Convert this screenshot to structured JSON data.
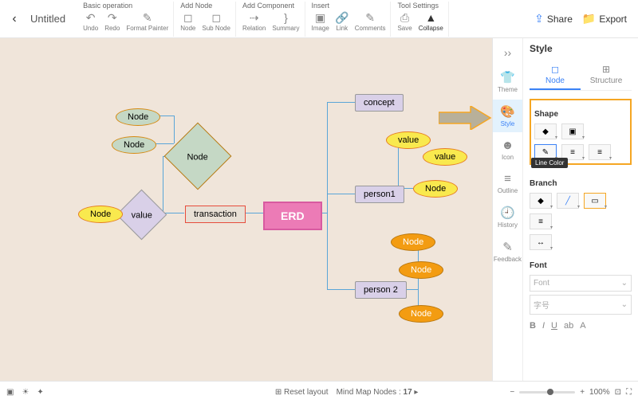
{
  "header": {
    "title": "Untitled",
    "share": "Share",
    "export": "Export",
    "groups": [
      {
        "title": "Basic operation",
        "items": [
          {
            "id": "undo",
            "label": "Undo",
            "icon": "↶"
          },
          {
            "id": "redo",
            "label": "Redo",
            "icon": "↷"
          },
          {
            "id": "format-painter",
            "label": "Format Painter",
            "icon": "✎"
          }
        ]
      },
      {
        "title": "Add Node",
        "items": [
          {
            "id": "node",
            "label": "Node",
            "icon": "◻"
          },
          {
            "id": "sub-node",
            "label": "Sub Node",
            "icon": "◻"
          }
        ]
      },
      {
        "title": "Add Component",
        "items": [
          {
            "id": "relation",
            "label": "Relation",
            "icon": "⇢"
          },
          {
            "id": "summary",
            "label": "Summary",
            "icon": "}"
          }
        ]
      },
      {
        "title": "Insert",
        "items": [
          {
            "id": "image",
            "label": "Image",
            "icon": "▣"
          },
          {
            "id": "link",
            "label": "Link",
            "icon": "🔗"
          },
          {
            "id": "comments",
            "label": "Comments",
            "icon": "✎"
          }
        ]
      },
      {
        "title": "Tool Settings",
        "items": [
          {
            "id": "save",
            "label": "Save",
            "icon": "⎙"
          },
          {
            "id": "collapse",
            "label": "Collapse",
            "icon": "▲"
          }
        ]
      }
    ]
  },
  "canvas": {
    "root": "ERD",
    "nodes": {
      "transaction": "transaction",
      "concept": "concept",
      "person1": "person1",
      "person2": "person 2",
      "node": "Node",
      "value": "value"
    }
  },
  "sideTabs": [
    {
      "id": "theme",
      "label": "Theme",
      "icon": "👕"
    },
    {
      "id": "style",
      "label": "Style",
      "icon": "🎨",
      "active": true
    },
    {
      "id": "icon",
      "label": "Icon",
      "icon": "☻"
    },
    {
      "id": "outline",
      "label": "Outline",
      "icon": "≡"
    },
    {
      "id": "history",
      "label": "History",
      "icon": "🕘"
    },
    {
      "id": "feedback",
      "label": "Feedback",
      "icon": "✎"
    }
  ],
  "panel": {
    "title": "Style",
    "tabs": [
      {
        "id": "node",
        "label": "Node",
        "active": true
      },
      {
        "id": "structure",
        "label": "Structure"
      }
    ],
    "shape": {
      "title": "Shape",
      "tooltip": "Line Color"
    },
    "branch": {
      "title": "Branch"
    },
    "font": {
      "title": "Font",
      "placeholder": "Font"
    },
    "formats": [
      "B",
      "I",
      "U",
      "ab",
      "A"
    ]
  },
  "footer": {
    "reset": "Reset layout",
    "nodeCountLabel": "Mind Map Nodes :",
    "nodeCount": "17",
    "zoom": "100%"
  },
  "chart_data": {
    "type": "mindmap-erd",
    "root": {
      "label": "ERD",
      "shape": "rect",
      "fill": "#ec7bb6"
    },
    "branches": [
      {
        "label": "transaction",
        "shape": "rect",
        "children": [
          {
            "label": "Node",
            "shape": "diamond",
            "fill": "#c5d8c5",
            "children": [
              {
                "label": "Node",
                "shape": "ellipse",
                "fill": "#c5d8c5"
              },
              {
                "label": "Node",
                "shape": "ellipse",
                "fill": "#c5d8c5"
              }
            ]
          },
          {
            "label": "value",
            "shape": "diamond",
            "children": [
              {
                "label": "Node",
                "shape": "ellipse",
                "fill": "#f9e94e"
              }
            ]
          }
        ]
      },
      {
        "label": "concept",
        "shape": "rect"
      },
      {
        "label": "person1",
        "shape": "rect",
        "children": [
          {
            "label": "value",
            "shape": "ellipse",
            "fill": "#f9e94e",
            "children": [
              {
                "label": "value",
                "shape": "ellipse",
                "fill": "#f9e94e"
              }
            ]
          },
          {
            "label": "Node",
            "shape": "ellipse",
            "fill": "#f9e94e"
          }
        ]
      },
      {
        "label": "person 2",
        "shape": "rect",
        "children": [
          {
            "label": "Node",
            "shape": "ellipse",
            "fill": "#f39c12"
          },
          {
            "label": "Node",
            "shape": "ellipse",
            "fill": "#f39c12"
          },
          {
            "label": "Node",
            "shape": "ellipse",
            "fill": "#f39c12"
          }
        ]
      }
    ]
  }
}
